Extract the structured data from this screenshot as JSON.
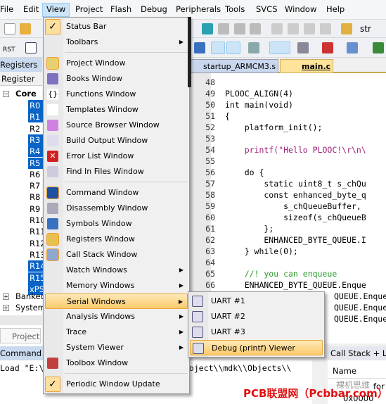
{
  "menubar": [
    "File",
    "Edit",
    "View",
    "Project",
    "Flash",
    "Debug",
    "Peripherals",
    "Tools",
    "SVCS",
    "Window",
    "Help"
  ],
  "toolbar": {
    "rst_label": "RST",
    "search_text": "str"
  },
  "left_panel": {
    "title": "Registers",
    "column": "Register",
    "root": "Core",
    "registers": [
      {
        "name": "R0",
        "selected": true
      },
      {
        "name": "R1",
        "selected": true
      },
      {
        "name": "R2",
        "selected": false
      },
      {
        "name": "R3",
        "selected": true
      },
      {
        "name": "R4",
        "selected": true
      },
      {
        "name": "R5",
        "selected": true
      },
      {
        "name": "R6",
        "selected": false
      },
      {
        "name": "R7",
        "selected": false
      },
      {
        "name": "R8",
        "selected": false
      },
      {
        "name": "R9",
        "selected": false
      },
      {
        "name": "R10",
        "selected": false
      },
      {
        "name": "R11",
        "selected": false
      },
      {
        "name": "R12",
        "selected": false
      },
      {
        "name": "R13",
        "selected": false
      },
      {
        "name": "R14",
        "selected": true
      },
      {
        "name": "R15",
        "selected": true
      },
      {
        "name": "xPSR",
        "selected": true
      }
    ],
    "groups": [
      "Banked",
      "System"
    ],
    "bottom_tab": "Project"
  },
  "tabs": [
    {
      "label": "startup_ARMCM3.s",
      "active": false
    },
    {
      "label": "main.c",
      "active": true
    }
  ],
  "code": [
    {
      "n": "48",
      "t": ""
    },
    {
      "n": "49",
      "t": "PLOOC_ALIGN(4)"
    },
    {
      "n": "50",
      "t": "int main(void)"
    },
    {
      "n": "51",
      "t": "{"
    },
    {
      "n": "52",
      "t": "    platform_init();"
    },
    {
      "n": "53",
      "t": ""
    },
    {
      "n": "54",
      "t": "    printf(\"Hello PLOOC!\\r\\n\\"
    },
    {
      "n": "55",
      "t": ""
    },
    {
      "n": "56",
      "t": "    do {"
    },
    {
      "n": "57",
      "t": "        static uint8_t s_chQu"
    },
    {
      "n": "58",
      "t": "        const enhanced_byte_q"
    },
    {
      "n": "59",
      "t": "            s_chQueueBuffer,"
    },
    {
      "n": "60",
      "t": "            sizeof(s_chQueueB"
    },
    {
      "n": "61",
      "t": "        };"
    },
    {
      "n": "62",
      "t": "        ENHANCED_BYTE_QUEUE.I"
    },
    {
      "n": "63",
      "t": "    } while(0);"
    },
    {
      "n": "64",
      "t": ""
    },
    {
      "n": "65",
      "t": "    //! you can enqueue"
    },
    {
      "n": "66",
      "t": "    ENHANCED_BYTE_QUEUE.Enque"
    },
    {
      "n": "",
      "t": "QUEUE.Enque"
    },
    {
      "n": "",
      "t": "QUEUE.Enque"
    },
    {
      "n": "",
      "t": "QUEUE.Enque"
    }
  ],
  "view_menu": [
    {
      "label": "Status Bar",
      "checked": true,
      "icon": "checkmark"
    },
    {
      "label": "Toolbars",
      "submenu": true
    },
    {
      "sep": true
    },
    {
      "label": "Project Window",
      "icon": "project-window",
      "active": true
    },
    {
      "label": "Books Window",
      "icon": "books"
    },
    {
      "label": "Functions Window",
      "icon": "braces"
    },
    {
      "label": "Templates Window",
      "icon": "templates"
    },
    {
      "label": "Source Browser Window",
      "icon": "source-browser"
    },
    {
      "label": "Build Output Window",
      "icon": "build-output"
    },
    {
      "label": "Error List Window",
      "icon": "error-x"
    },
    {
      "label": "Find In Files Window",
      "icon": "find-in-files"
    },
    {
      "sep": true
    },
    {
      "label": "Command Window",
      "icon": "command",
      "active": true
    },
    {
      "label": "Disassembly Window",
      "icon": "disassembly"
    },
    {
      "label": "Symbols Window",
      "icon": "symbols"
    },
    {
      "label": "Registers Window",
      "icon": "registers",
      "active": true
    },
    {
      "label": "Call Stack Window",
      "icon": "call-stack",
      "active": true
    },
    {
      "label": "Watch Windows",
      "submenu": true
    },
    {
      "label": "Memory Windows",
      "submenu": true
    },
    {
      "label": "Serial Windows",
      "submenu": true,
      "highlighted": true
    },
    {
      "label": "Analysis Windows",
      "submenu": true
    },
    {
      "label": "Trace",
      "submenu": true
    },
    {
      "label": "System Viewer",
      "submenu": true
    },
    {
      "label": "Toolbox Window",
      "icon": "toolbox"
    },
    {
      "sep": true
    },
    {
      "label": "Periodic Window Update",
      "checked": true,
      "icon": "checkmark"
    }
  ],
  "serial_submenu": [
    {
      "label": "UART #1"
    },
    {
      "label": "UART #2"
    },
    {
      "label": "UART #3"
    },
    {
      "label": "Debug (printf) Viewer",
      "highlighted": true
    }
  ],
  "command": {
    "title": "Command",
    "text": "Load \"E:\\",
    "text2": "roject\\\\mdk\\\\Objects\\\\"
  },
  "callstack": {
    "title": "Call Stack + Loc",
    "column": "Name",
    "partial": "for",
    "value": "0x0000"
  },
  "watermark": {
    "text": "PCB联盟网（Pcbbar.com）",
    "wechat": "裸机思维"
  },
  "colors": {
    "selection": "#0a64c8",
    "menu_highlight": "#fbc96a",
    "tab_active": "#fde49a"
  }
}
